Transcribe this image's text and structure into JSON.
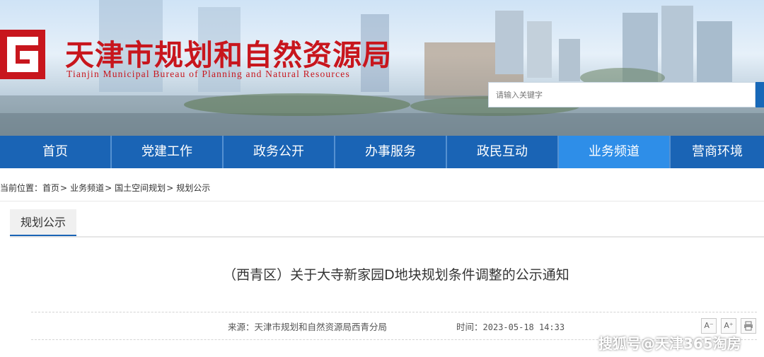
{
  "header": {
    "title": "天津市规划和自然资源局",
    "subtitle": "Tianjin Municipal Bureau of Planning and Natural Resources",
    "logo_icon": "tianjin-bureau-logo",
    "brand_color": "#c8161d"
  },
  "search": {
    "placeholder": "请输入关键字"
  },
  "nav": {
    "items": [
      "首页",
      "党建工作",
      "政务公开",
      "办事服务",
      "政民互动",
      "业务频道",
      "营商环境"
    ],
    "active_index": 5,
    "bg_color": "#1a64b5",
    "active_color": "#2e8ee8"
  },
  "breadcrumb": {
    "prefix": "当前位置：",
    "items": [
      "首页",
      "业务频道",
      "国土空间规划",
      "规划公示"
    ],
    "separator": ">"
  },
  "section_tab": "规划公示",
  "article": {
    "title": "（西青区）关于大寺新家园D地块规划条件调整的公示通知",
    "source_label": "来源：",
    "source": "天津市规划和自然资源局西青分局",
    "time_label": "时间：",
    "time": "2023-05-18 14:33"
  },
  "tools": {
    "font_decrease": "A⁻",
    "font_increase": "A⁺",
    "print_icon": "print-icon"
  },
  "watermark": "搜狐号@天津365淘房"
}
